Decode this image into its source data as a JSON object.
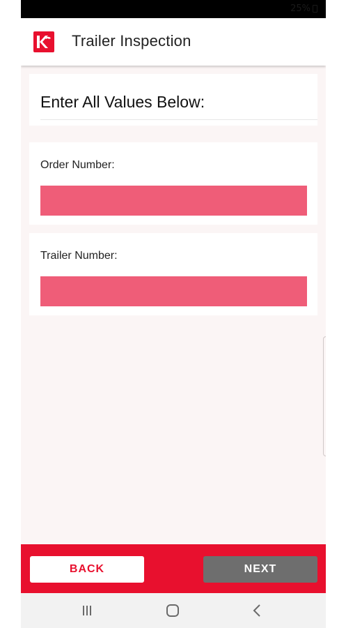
{
  "status_bar": {
    "battery_text": "25%"
  },
  "app_bar": {
    "title": "Trailer Inspection",
    "logo_icon": "kf-logo"
  },
  "header_card": {
    "title": "Enter All Values Below:"
  },
  "fields": [
    {
      "label": "Order Number:",
      "value": ""
    },
    {
      "label": "Trailer Number:",
      "value": ""
    }
  ],
  "buttons": {
    "back": "BACK",
    "next": "NEXT"
  },
  "nav": {
    "recent_icon": "recent-apps-icon",
    "home_icon": "home-icon",
    "back_icon": "back-icon"
  },
  "colors": {
    "brand_red": "#e8102e",
    "input_fill": "#ef5d78",
    "next_gray": "#6e6e6e",
    "background": "#fbf5f5"
  }
}
